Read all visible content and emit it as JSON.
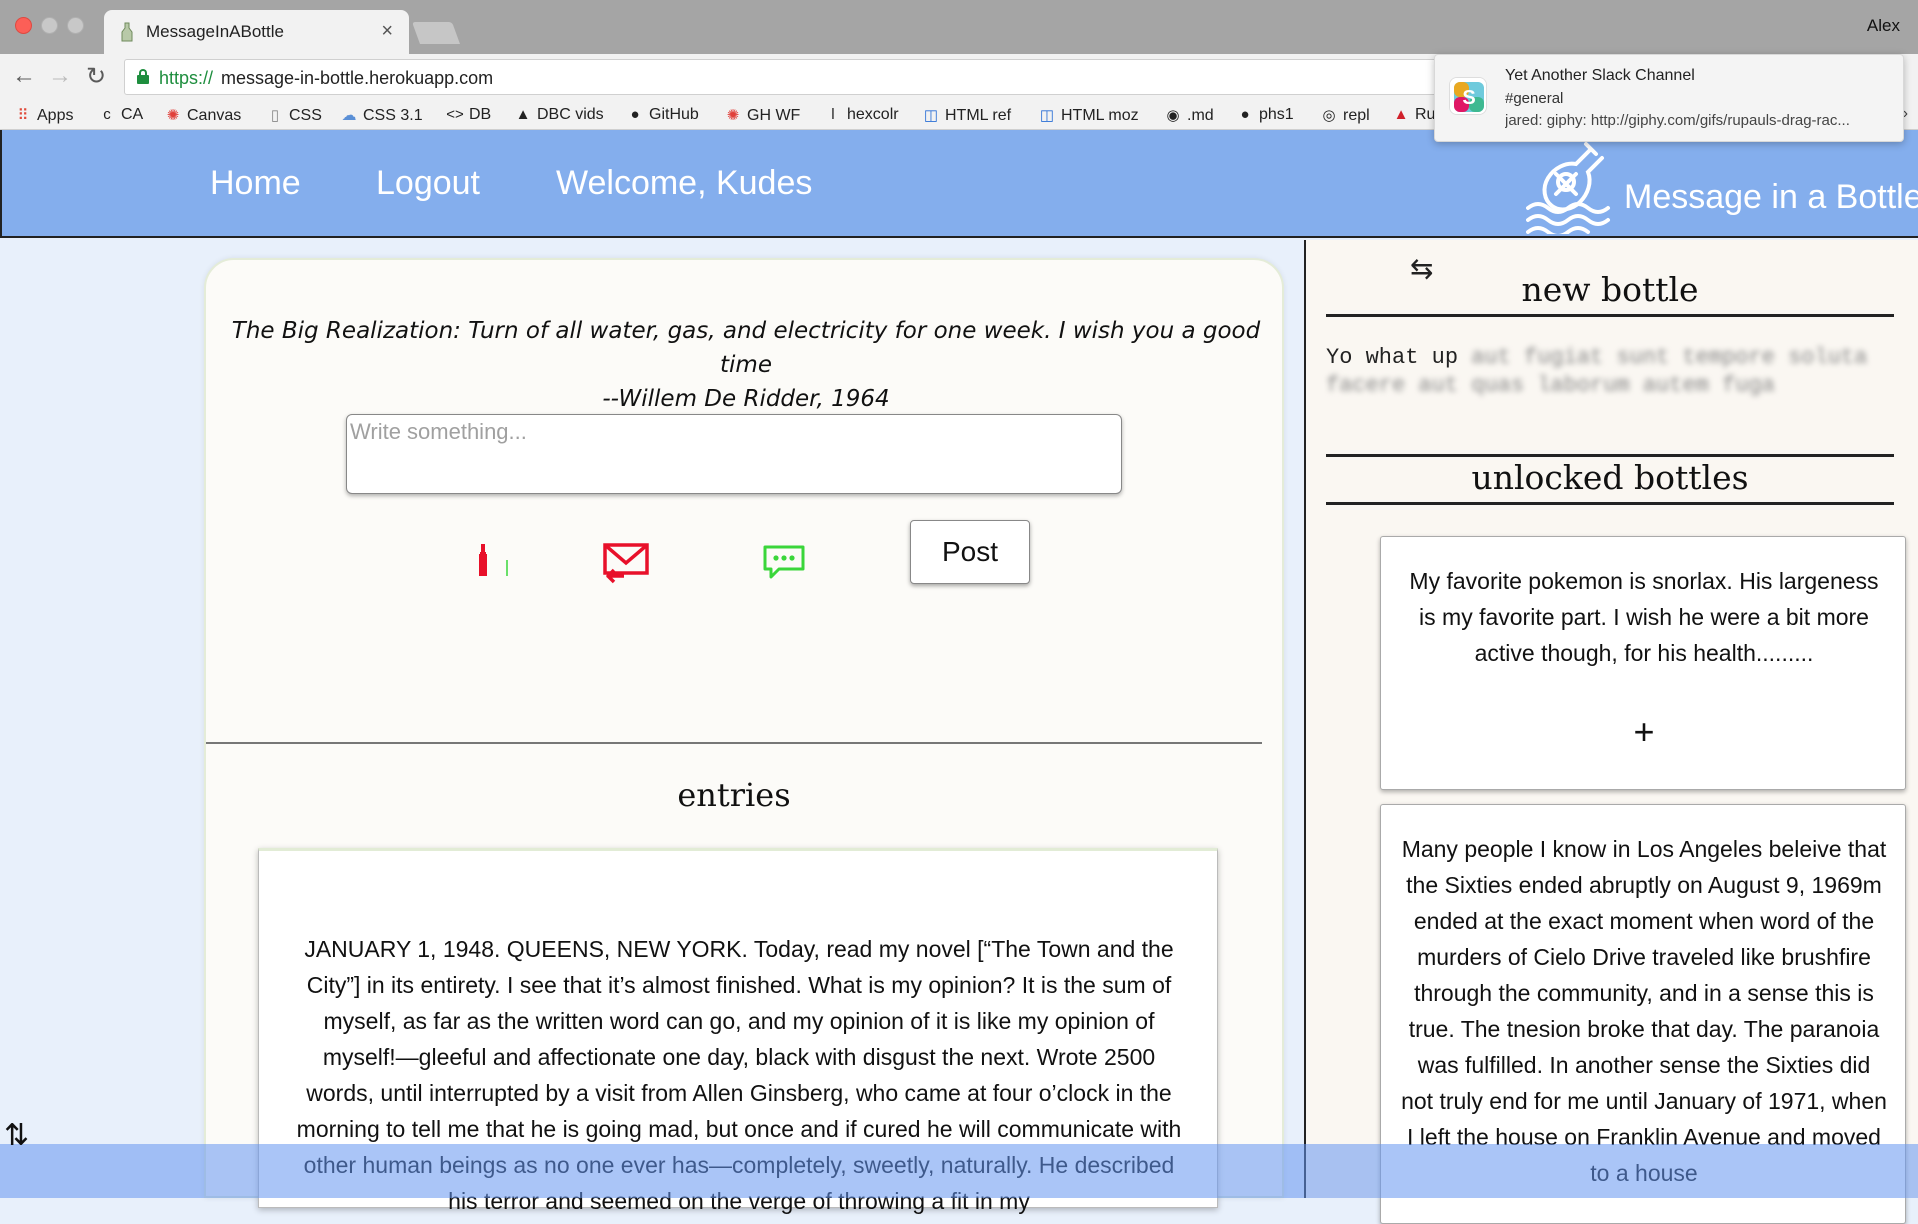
{
  "browser": {
    "tab_title": "MessageInABottle",
    "tab_close": "×",
    "profile_name": "Alex",
    "url_scheme": "https://",
    "url_host": "message-in-bottle.herokuapp.com",
    "back_glyph": "←",
    "forward_glyph": "→",
    "reload_glyph": "↻",
    "bookmarks": [
      {
        "label": "Apps",
        "icon": "⠿"
      },
      {
        "label": "CA",
        "icon": "c"
      },
      {
        "label": "Canvas",
        "icon": "✺"
      },
      {
        "label": "CSS",
        "icon": "▯"
      },
      {
        "label": "CSS 3.1",
        "icon": "☁"
      },
      {
        "label": "DB",
        "icon": "<>"
      },
      {
        "label": "DBC vids",
        "icon": "▲"
      },
      {
        "label": "GitHub",
        "icon": "●"
      },
      {
        "label": "GH WF",
        "icon": "✺"
      },
      {
        "label": "hexcolr",
        "icon": "ǀ"
      },
      {
        "label": "HTML ref",
        "icon": "◫"
      },
      {
        "label": "HTML moz",
        "icon": "◫"
      },
      {
        "label": ".md",
        "icon": "◉"
      },
      {
        "label": "phs1",
        "icon": "●"
      },
      {
        "label": "repl",
        "icon": "◎"
      },
      {
        "label": "Ru",
        "icon": "▲"
      }
    ],
    "bookmarks_more": "»"
  },
  "notification": {
    "title": "Yet Another Slack Channel",
    "channel": "#general",
    "body": "jared: giphy: http://giphy.com/gifs/rupauls-drag-rac..."
  },
  "header": {
    "nav": [
      {
        "label": "Home"
      },
      {
        "label": "Logout"
      },
      {
        "label": "Welcome, Kudes"
      }
    ],
    "logo_text": "Message in a Bottle"
  },
  "main": {
    "quote_line1": "The Big Realization: Turn of all water, gas, and electricity for one week. I wish you a good time",
    "quote_line2": "--Willem De Ridder, 1964",
    "compose_placeholder": "Write something...",
    "post_label": "Post",
    "entries_heading": "entries",
    "entry_text": "JANUARY 1, 1948. QUEENS, NEW YORK. Today, read my novel [“The Town and the City”] in its entirety. I see that it’s almost finished. What is my opinion? It is the sum of myself, as far as the written word can go, and my opinion of it is like my opinion of myself!—gleeful and affectionate one day, black with disgust the next. Wrote 2500 words, until interrupted by a visit from Allen Ginsberg, who came at four o’clock in the morning to tell me that he is going mad, but once and if cured he will communicate with other human beings as no one ever has—completely, sweetly, naturally. He described his terror and seemed on the verge of throwing a fit in my"
  },
  "sidebar": {
    "swap_glyph": "⇆",
    "new_bottle_heading": "new bottle",
    "new_bottle_visible": "Yo what up ",
    "new_bottle_blurred": "aut fugiat sunt tempore soluta facere aut quas laborum autem fuga",
    "unlocked_heading": "unlocked bottles",
    "bottles": [
      {
        "text": "My favorite pokemon is snorlax. His largeness is my favorite part. I wish he were a bit more active though, for his health.........",
        "plus": "+"
      },
      {
        "text": "Many people I know in Los Angeles beleive that the Sixties ended abruptly on August 9, 1969m ended at the exact moment when word of the murders of Cielo Drive traveled like brushfire through the community, and in a sense this is true. The tnesion broke that day. The paranoia was fulfilled. In another sense the Sixties did not truly end for me until January of 1971, when I left the house on Franklin Avenue and moved to a house"
      }
    ]
  },
  "scroll_toggle_glyph": "⇅",
  "colors": {
    "header_blue": "#84aeed",
    "bottle_red": "#e8102a",
    "chat_green": "#3ad63a"
  }
}
